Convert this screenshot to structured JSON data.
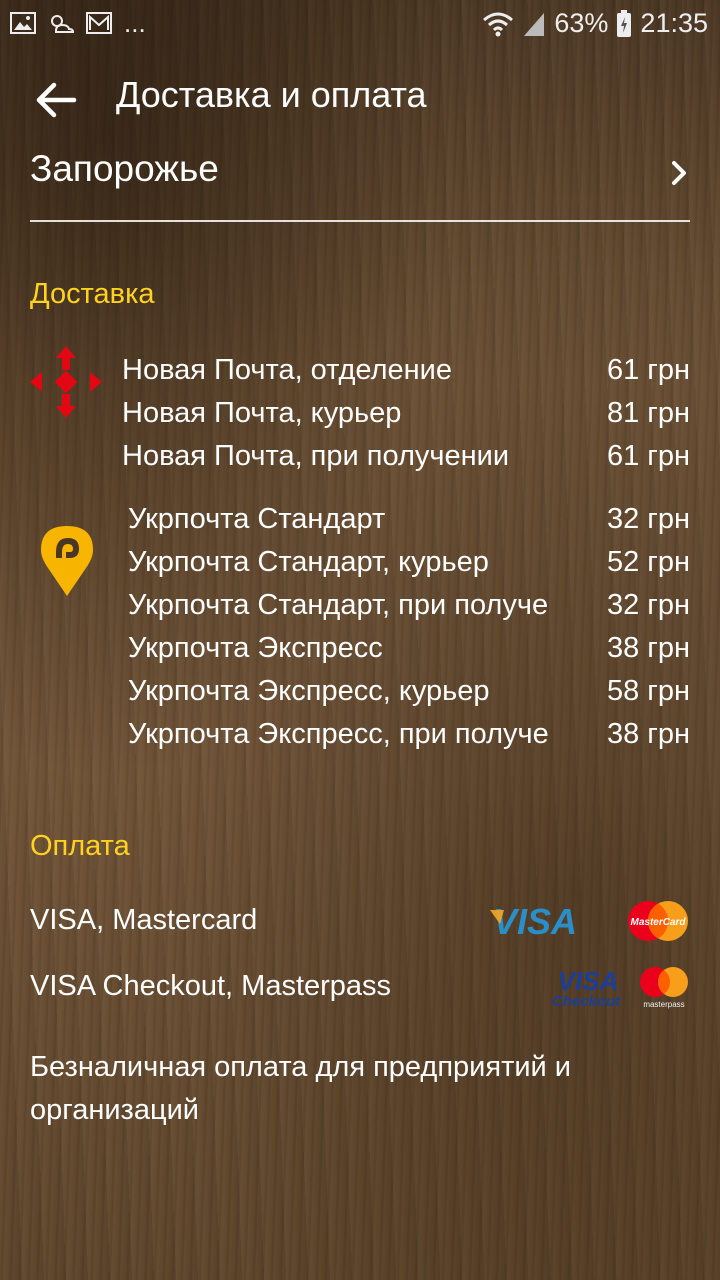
{
  "status_bar": {
    "battery": "63%",
    "time": "21:35",
    "more": "..."
  },
  "header": {
    "title": "Доставка и оплата"
  },
  "city": {
    "label": "Запорожье"
  },
  "delivery": {
    "title": "Доставка",
    "nova_poshta": [
      {
        "name": "Новая Почта, отделение",
        "price": "61 грн"
      },
      {
        "name": "Новая Почта, курьер",
        "price": "81 грн"
      },
      {
        "name": "Новая Почта, при получении",
        "price": "61 грн"
      }
    ],
    "ukrposhta": [
      {
        "name": "Укрпочта Стандарт",
        "price": "32 грн"
      },
      {
        "name": "Укрпочта Стандарт, курьер",
        "price": "52 грн"
      },
      {
        "name": "Укрпочта Стандарт, при получении",
        "price": "32 грн"
      },
      {
        "name": "Укрпочта Экспресс",
        "price": "38 грн"
      },
      {
        "name": "Укрпочта Экспресс, курьер",
        "price": "58 грн"
      },
      {
        "name": "Укрпочта Экспресс, при получении",
        "price": "38 грн"
      }
    ]
  },
  "payment": {
    "title": "Оплата",
    "methods": [
      "VISA, Mastercard",
      "VISA Checkout, Masterpass",
      "Безналичная оплата для предприятий и организаций"
    ],
    "logos": {
      "visa": "VISA",
      "mastercard": "MasterCard",
      "visa_checkout_top": "VISA",
      "visa_checkout_bottom": "Checkout",
      "masterpass": "masterpass"
    }
  },
  "colors": {
    "accent_yellow": "#ffd21f",
    "nova_poshta_red": "#e30613",
    "ukrposhta_yellow": "#f7b500"
  },
  "icons": {
    "back": "arrow-left-icon",
    "city_chevron": "chevron-right-icon",
    "nova_poshta": "nova-poshta-logo-icon",
    "ukrposhta": "ukrposhta-logo-icon"
  }
}
